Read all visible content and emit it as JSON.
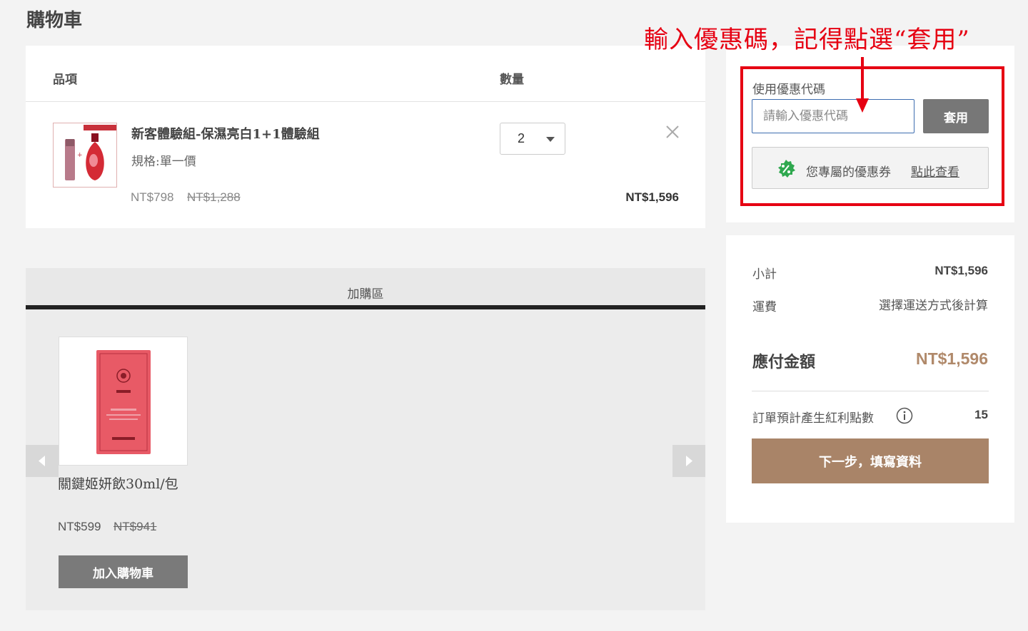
{
  "page": {
    "title": "購物車"
  },
  "cart": {
    "header": {
      "item": "品項",
      "quantity": "數量"
    },
    "item": {
      "name": "新客體驗組-保濕亮白1+1體驗組",
      "spec": "規格:單一價",
      "price": "NT$798",
      "original_price": "NT$1,288",
      "quantity": "2",
      "line_total": "NT$1,596"
    }
  },
  "addon": {
    "title": "加購區",
    "product": {
      "name": "關鍵姬妍飲30ml/包",
      "price": "NT$599",
      "original_price": "NT$941",
      "add_button": "加入購物車"
    }
  },
  "coupon": {
    "label": "使用優惠代碼",
    "placeholder": "請輸入優惠代碼",
    "apply_button": "套用",
    "my_coupon_text": "您專屬的優惠券",
    "my_coupon_link": "點此查看"
  },
  "annotation": {
    "text": "輸入優惠碼，記得點選“套用”",
    "color": "#e60012"
  },
  "summary": {
    "subtotal_label": "小計",
    "subtotal_value": "NT$1,596",
    "shipping_label": "運費",
    "shipping_value": "選擇運送方式後計算",
    "total_label": "應付金額",
    "total_value": "NT$1,596",
    "points_label": "訂單預計產生紅利點數",
    "points_value": "15",
    "next_button": "下一步，填寫資料"
  },
  "colors": {
    "accent": "#a98468",
    "total_text": "#b0896a",
    "coupon_badge": "#2fa84f"
  }
}
